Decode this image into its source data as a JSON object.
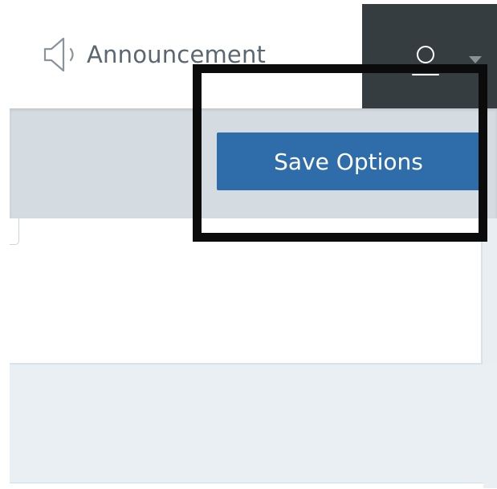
{
  "header": {
    "announcement": {
      "label": "Announcement",
      "icon": "megaphone-icon"
    },
    "user_menu": {
      "icon": "user-avatar-icon",
      "caret_icon": "caret-down-icon",
      "background": "#363d40"
    }
  },
  "toolbar": {
    "save_label": "Save Options",
    "accent_color": "#2f6daa"
  }
}
